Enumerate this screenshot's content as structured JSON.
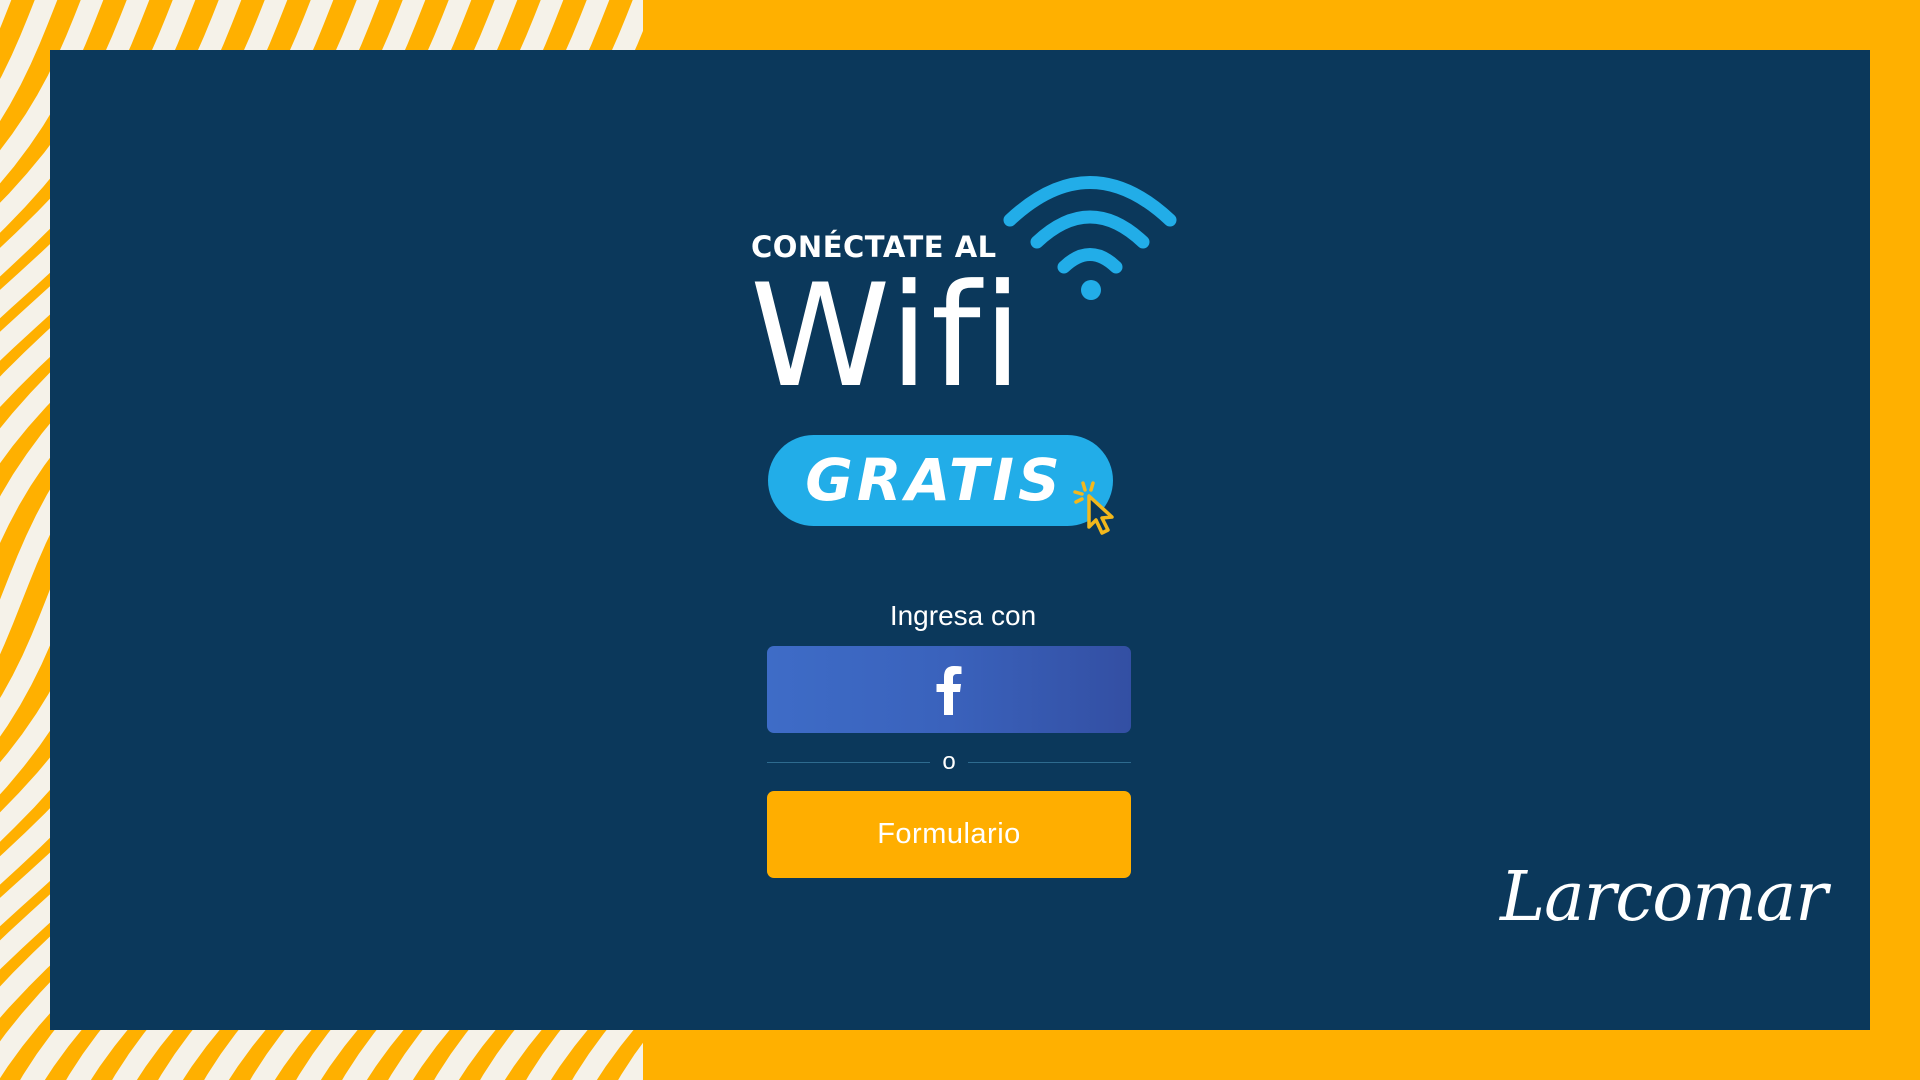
{
  "colors": {
    "frame": "#FFB000",
    "stripe": "#F5F2E9",
    "panel": "#0B385B",
    "accent_blue": "#22ADE8",
    "facebook": "#3B5CB5",
    "form_button": "#FFAE00",
    "cursor": "#F3B81C"
  },
  "hero": {
    "line1": "CONÉCTATE AL",
    "word": "Wifi",
    "badge": "GRATIS",
    "icons": [
      "wifi-signal-icon",
      "click-cursor-icon"
    ]
  },
  "login": {
    "intro": "Ingresa con",
    "facebook_icon": "facebook-f-icon",
    "divider": "o",
    "form_button": "Formulario"
  },
  "brand": {
    "logo_text": "Larcomar"
  }
}
